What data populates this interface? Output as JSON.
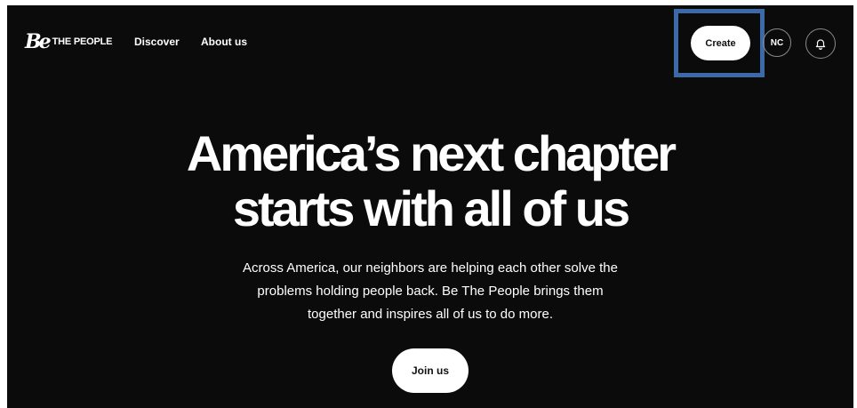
{
  "header": {
    "logo_mark": "Be",
    "logo_text": "THE PEOPLE",
    "nav": [
      {
        "label": "Discover"
      },
      {
        "label": "About us"
      }
    ],
    "create_label": "Create",
    "avatar_initials": "NC",
    "bell_icon": "bell-icon"
  },
  "hero": {
    "title_line1": "America’s next chapter",
    "title_line2": "starts with all of us",
    "body_line1": "Across America, our neighbors are helping each other solve the",
    "body_line2": "problems holding people back. Be The People brings them",
    "body_line3": "together and inspires all of us to do more.",
    "cta_label": "Join us"
  },
  "colors": {
    "background": "#0b0b0b",
    "text": "#ffffff",
    "highlight": "#3c6aa8"
  }
}
